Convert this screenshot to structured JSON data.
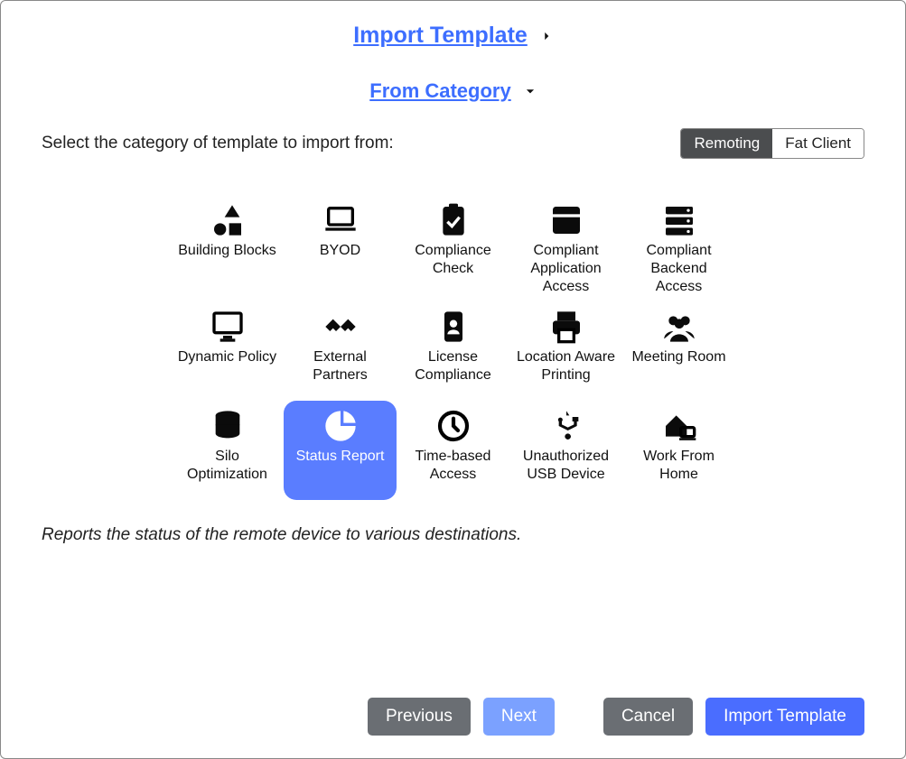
{
  "headings": {
    "import_template": "Import Template",
    "from_category": "From Category"
  },
  "subtitle": "Select the category of template to import from:",
  "toggle": {
    "remoting": "Remoting",
    "fat_client": "Fat Client"
  },
  "categories": [
    {
      "id": "building-blocks",
      "label": "Building Blocks",
      "icon": "shapes"
    },
    {
      "id": "byod",
      "label": "BYOD",
      "icon": "laptop"
    },
    {
      "id": "compliance-check",
      "label": "Compliance Check",
      "icon": "clipboard-check"
    },
    {
      "id": "compliant-application-access",
      "label": "Compliant Application Access",
      "icon": "window-max"
    },
    {
      "id": "compliant-backend-access",
      "label": "Compliant Backend Access",
      "icon": "server"
    },
    {
      "id": "dynamic-policy",
      "label": "Dynamic Policy",
      "icon": "monitor"
    },
    {
      "id": "external-partners",
      "label": "External Partners",
      "icon": "handshake"
    },
    {
      "id": "license-compliance",
      "label": "License Compliance",
      "icon": "id-badge"
    },
    {
      "id": "location-aware-printing",
      "label": "Location Aware Printing",
      "icon": "printer"
    },
    {
      "id": "meeting-room",
      "label": "Meeting Room",
      "icon": "users"
    },
    {
      "id": "silo-optimization",
      "label": "Silo Optimization",
      "icon": "database"
    },
    {
      "id": "status-report",
      "label": "Status Report",
      "icon": "pie",
      "selected": true
    },
    {
      "id": "time-based-access",
      "label": "Time-based Access",
      "icon": "clock"
    },
    {
      "id": "unauthorized-usb-device",
      "label": "Unauthorized USB Device",
      "icon": "usb"
    },
    {
      "id": "work-from-home",
      "label": "Work From Home",
      "icon": "house-laptop"
    }
  ],
  "description": "Reports the status of the remote device to various destinations.",
  "buttons": {
    "previous": "Previous",
    "next": "Next",
    "cancel": "Cancel",
    "import_template": "Import Template"
  }
}
